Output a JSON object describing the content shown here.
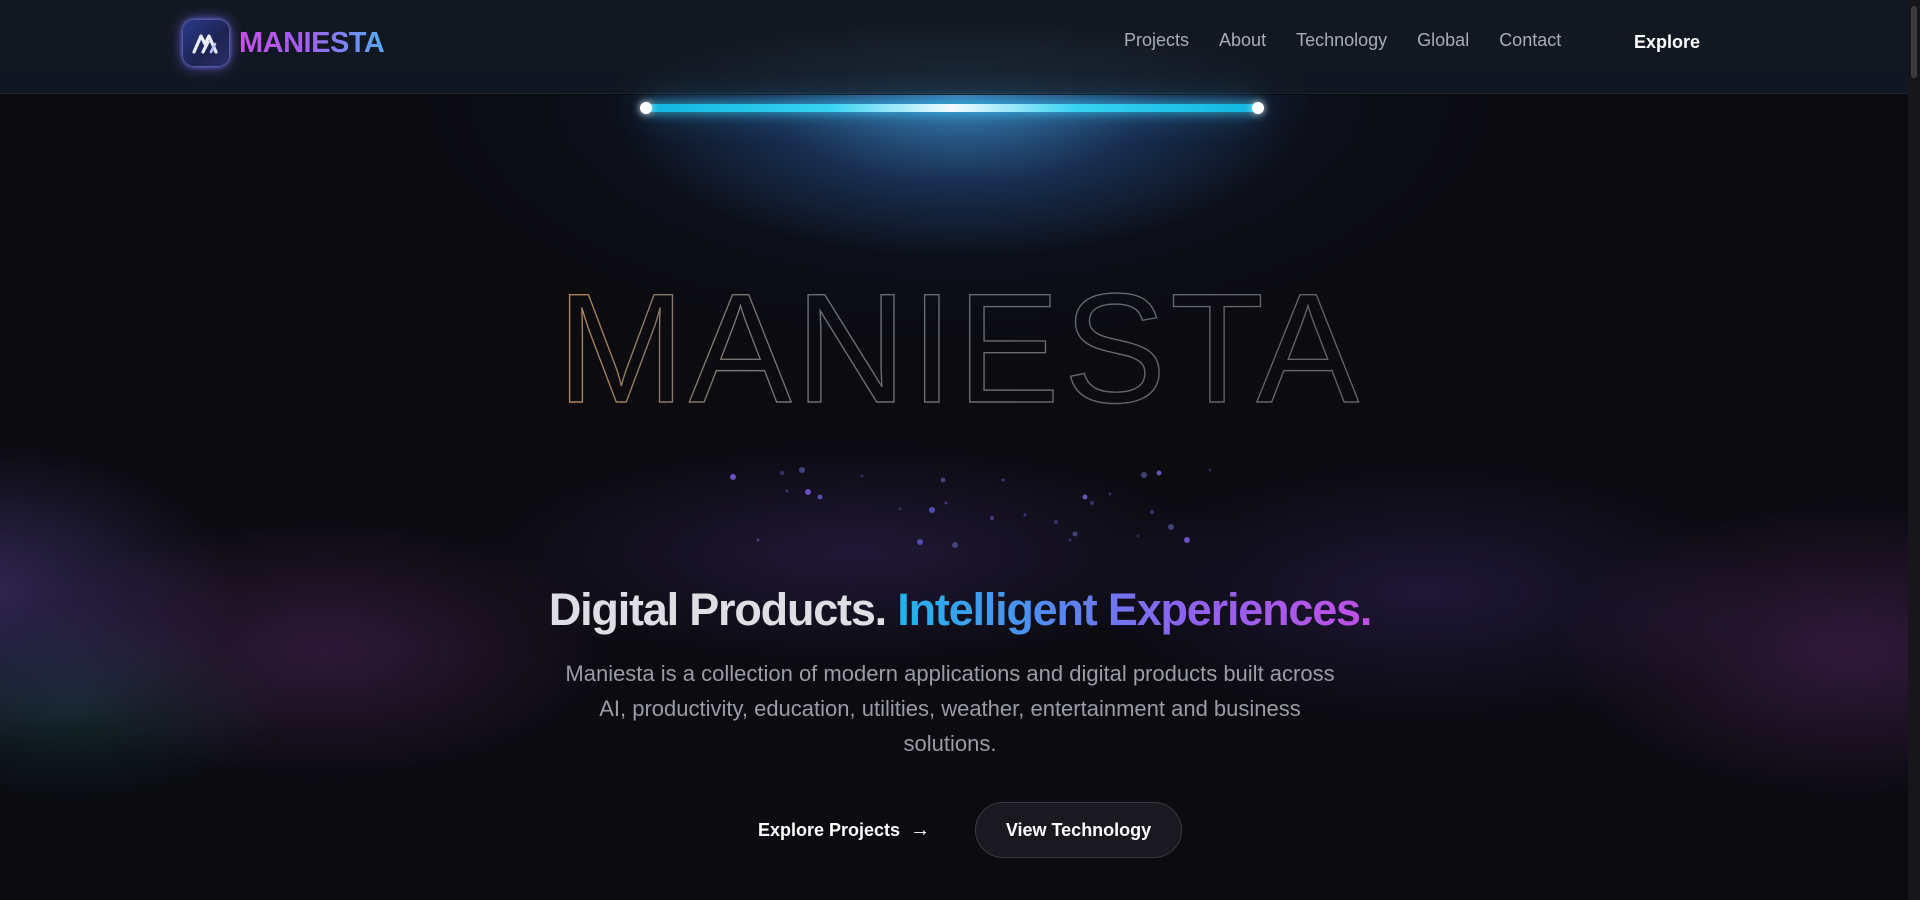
{
  "brand": {
    "name": "MANIESTA",
    "logo_icon": "maniesta-logo-icon"
  },
  "nav": {
    "items": [
      {
        "label": "Projects"
      },
      {
        "label": "About"
      },
      {
        "label": "Technology"
      },
      {
        "label": "Global"
      },
      {
        "label": "Contact"
      }
    ],
    "cta_label": "Explore"
  },
  "hero": {
    "outline_word": "MANIESTA",
    "headline_white": "Digital Products.",
    "headline_gradient": "Intelligent Experiences.",
    "description": "Maniesta is a collection of modern applications and digital products built across AI, productivity, education, utilities, weather, entertainment and business solutions.",
    "primary_button": {
      "label": "Explore Projects",
      "arrow": "→"
    },
    "secondary_button": {
      "label": "View Technology"
    }
  },
  "colors": {
    "background": "#0b0b10",
    "accent_cyan": "#22b4ec",
    "accent_purple": "#8c63ee",
    "accent_magenta": "#c24fe6"
  }
}
